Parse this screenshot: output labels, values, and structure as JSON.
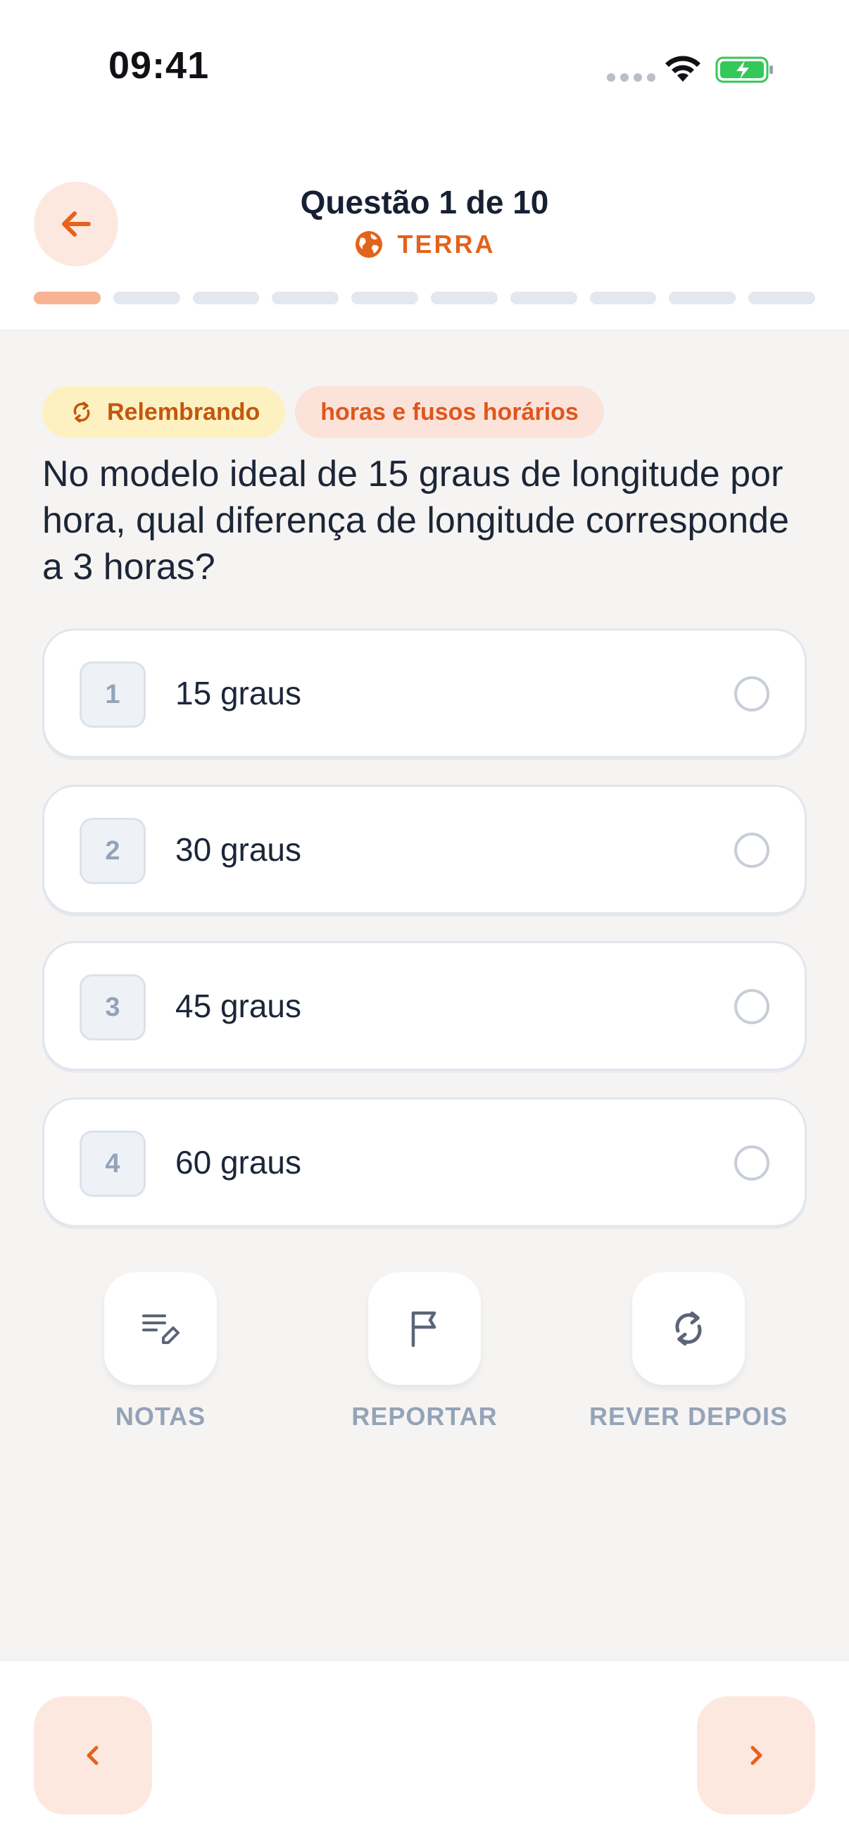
{
  "status_bar": {
    "time": "09:41",
    "battery_color": "#34c759"
  },
  "header": {
    "title": "Questão 1 de 10",
    "subject": "TERRA",
    "subject_icon": "globe-icon",
    "back_icon": "arrow-left-icon",
    "progress": {
      "current": 1,
      "total": 10
    },
    "accent_color": "#e5621a"
  },
  "tags": {
    "review_label": "Relembrando",
    "review_icon": "refresh-icon",
    "topic_label": "horas e fusos horários"
  },
  "question": {
    "text": "No modelo ideal de 15 graus de longitude por hora, qual diferença de longitude corresponde a 3 horas?"
  },
  "options": [
    {
      "number": "1",
      "text": "15 graus"
    },
    {
      "number": "2",
      "text": "30 graus"
    },
    {
      "number": "3",
      "text": "45 graus"
    },
    {
      "number": "4",
      "text": "60 graus"
    }
  ],
  "actions": {
    "notes_label": "NOTAS",
    "notes_icon": "notes-edit-icon",
    "report_label": "REPORTAR",
    "report_icon": "flag-icon",
    "review_later_label": "REVER DEPOIS",
    "review_later_icon": "refresh-icon"
  },
  "navigation": {
    "prev_icon": "chevron-left-icon",
    "next_icon": "chevron-right-icon"
  }
}
